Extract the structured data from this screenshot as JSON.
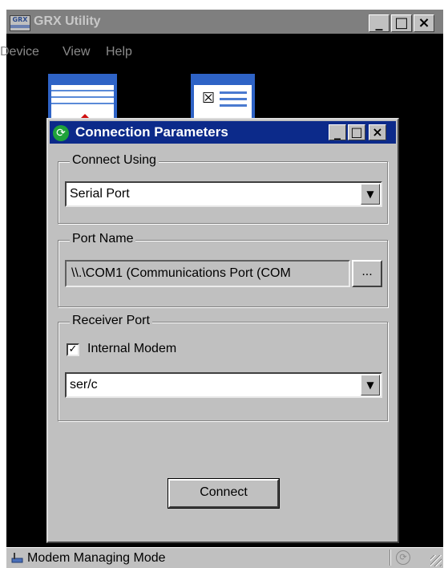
{
  "app": {
    "title": "GRX Utility",
    "logo_text": "GRX"
  },
  "title_buttons": {
    "minimize": "_",
    "maximize": "□",
    "close": "×"
  },
  "menu": {
    "items": [
      "Device",
      "View",
      "Help"
    ]
  },
  "dialog": {
    "title": "Connection Parameters",
    "connect_using": {
      "label": "Connect Using",
      "value": "Serial Port"
    },
    "port_name": {
      "label": "Port Name",
      "value": "\\\\.\\COM1 (Communications Port (COM",
      "browse_label": "..."
    },
    "receiver_port": {
      "label": "Receiver Port",
      "internal_modem_label": "Internal Modem",
      "internal_modem_checked": true,
      "value": "ser/c"
    },
    "connect_button": "Connect"
  },
  "status": {
    "text": "Modem Managing Mode"
  },
  "icons": {
    "app_logo": "grx-logo-icon",
    "dialog_icon": "connection-refresh-icon",
    "status_icon": "modem-icon",
    "status_right_icon": "sync-icon"
  },
  "colors": {
    "dialog_title_bg": "#0c2a8a",
    "inactive_title_bg": "#7f7f7f",
    "face": "#c0c0c0"
  }
}
